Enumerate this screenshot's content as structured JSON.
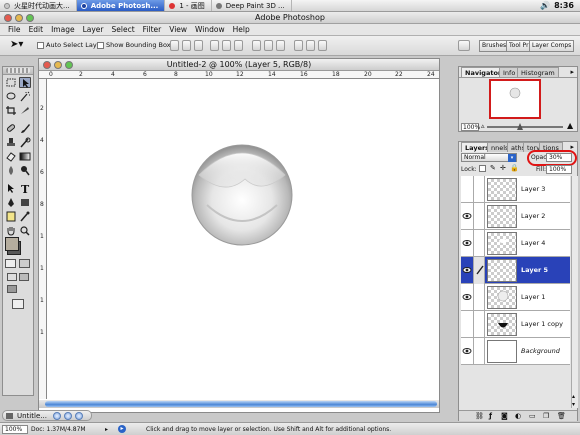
{
  "macbar": {
    "tabs": [
      {
        "label": "火星时代动画大...",
        "active": false,
        "dot": "#c8c8c8"
      },
      {
        "label": "Adobe Photosh...",
        "active": true,
        "dot": "#1a3f9e"
      },
      {
        "label": "1 - 画图",
        "active": false,
        "dot": "#d33"
      },
      {
        "label": "Deep Paint 3D ...",
        "active": false,
        "dot": "#777"
      }
    ],
    "clock": "8:36"
  },
  "window_title": "Adobe Photoshop",
  "menu": [
    "File",
    "Edit",
    "Image",
    "Layer",
    "Select",
    "Filter",
    "View",
    "Window",
    "Help"
  ],
  "options": {
    "auto_select": "Auto Select Layer",
    "bounding_box": "Show Bounding Box",
    "wells": [
      "Brushes",
      "Tool Pr",
      "Layer Comps"
    ]
  },
  "document": {
    "title": "Untitled-2 @ 100% (Layer 5, RGB/8)",
    "ruler_h": [
      "0",
      "2",
      "4",
      "6",
      "8",
      "10",
      "12",
      "14",
      "16",
      "18",
      "20",
      "22",
      "24"
    ],
    "ruler_v": [
      "2",
      "4",
      "6",
      "8",
      "1",
      "1",
      "1",
      "1"
    ]
  },
  "status": {
    "zoom": "100%",
    "doc": "Doc: 1.37M/4.87M",
    "hint": "Click and drag to move layer or selection.  Use Shift and Alt for additional options."
  },
  "minimized_doc": "Untitle...",
  "navigator": {
    "tabs": [
      "Navigator",
      "Info",
      "Histogram"
    ],
    "zoom": "100%"
  },
  "layers_panel": {
    "tabs": [
      "Layers",
      "nnels",
      "aths",
      "tory",
      "tions"
    ],
    "blend_mode": "Normal",
    "opacity_label": "Opacity:",
    "opacity": "30%",
    "lock_label": "Lock:",
    "fill_label": "Fill:",
    "fill": "100%",
    "layers": [
      {
        "name": "Layer 3",
        "visible": false,
        "selected": false,
        "thumb": "checker",
        "italic": false
      },
      {
        "name": "Layer 2",
        "visible": true,
        "selected": false,
        "thumb": "checker",
        "italic": false
      },
      {
        "name": "Layer 4",
        "visible": true,
        "selected": false,
        "thumb": "checker-glow",
        "italic": false
      },
      {
        "name": "Layer 5",
        "visible": true,
        "selected": true,
        "thumb": "checker",
        "italic": false
      },
      {
        "name": "Layer 1",
        "visible": true,
        "selected": false,
        "thumb": "checker-sphere",
        "italic": false
      },
      {
        "name": "Layer 1 copy",
        "visible": false,
        "selected": false,
        "thumb": "checker-dark",
        "italic": false
      },
      {
        "name": "Background",
        "visible": true,
        "selected": false,
        "thumb": "white",
        "italic": true
      }
    ]
  }
}
